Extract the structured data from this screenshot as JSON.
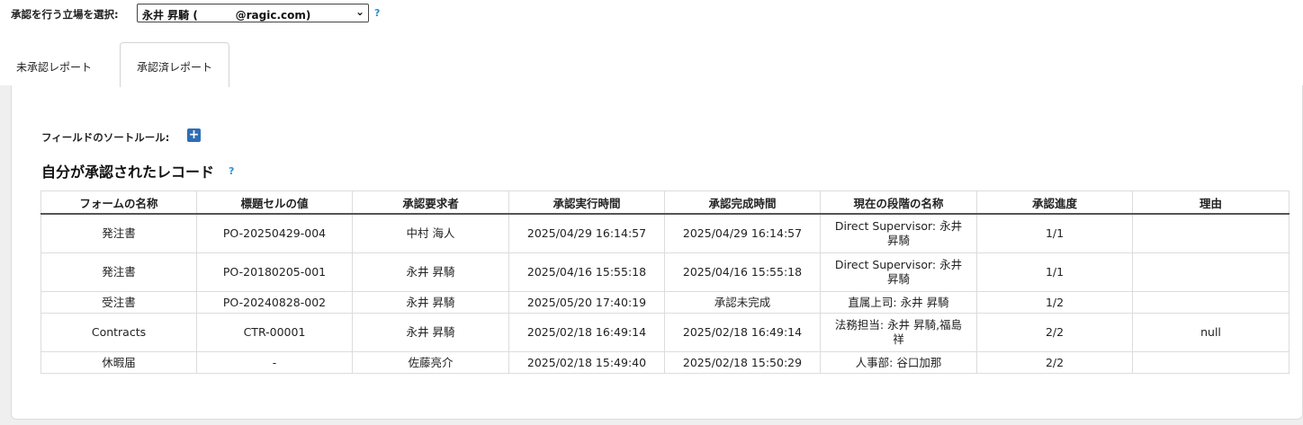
{
  "role_selector": {
    "label": "承認を行う立場を選択:",
    "selected": "永井 昇騎 (          @ragic.com)",
    "help": "?"
  },
  "tabs": [
    {
      "label": "未承認レポート"
    },
    {
      "label": "承認済レポート"
    }
  ],
  "sort_rule": {
    "label": "フィールドのソートルール:",
    "add": "+"
  },
  "section": {
    "title": "自分が承認されたレコード",
    "help": "?"
  },
  "table": {
    "columns": [
      "フォームの名称",
      "標題セルの値",
      "承認要求者",
      "承認実行時間",
      "承認完成時間",
      "現在の段階の名称",
      "承認進度",
      "理由"
    ],
    "rows": [
      {
        "form": "発注書",
        "title_value": "PO-20250429-004",
        "requester": "中村 海人",
        "executed": "2025/04/29 16:14:57",
        "completed": "2025/04/29 16:14:57",
        "stage_l1": "Direct Supervisor: 永井",
        "stage_l2": "昇騎",
        "progress": "1/1",
        "reason": ""
      },
      {
        "form": "発注書",
        "title_value": "PO-20180205-001",
        "requester": "永井 昇騎",
        "executed": "2025/04/16 15:55:18",
        "completed": "2025/04/16 15:55:18",
        "stage_l1": "Direct Supervisor: 永井",
        "stage_l2": "昇騎",
        "progress": "1/1",
        "reason": ""
      },
      {
        "form": "受注書",
        "title_value": "PO-20240828-002",
        "requester": "永井 昇騎",
        "executed": "2025/05/20 17:40:19",
        "completed": "承認未完成",
        "stage_l1": "直属上司: 永井 昇騎",
        "stage_l2": "",
        "progress": "1/2",
        "reason": ""
      },
      {
        "form": "Contracts",
        "title_value": "CTR-00001",
        "requester": "永井 昇騎",
        "executed": "2025/02/18 16:49:14",
        "completed": "2025/02/18 16:49:14",
        "stage_l1": "法務担当: 永井 昇騎,福島",
        "stage_l2": "祥",
        "progress": "2/2",
        "reason": "null"
      },
      {
        "form": "休暇届",
        "title_value": "-",
        "requester": "佐藤亮介",
        "executed": "2025/02/18 15:49:40",
        "completed": "2025/02/18 15:50:29",
        "stage_l1": "人事部: 谷口加那",
        "stage_l2": "",
        "progress": "2/2",
        "reason": ""
      }
    ]
  }
}
